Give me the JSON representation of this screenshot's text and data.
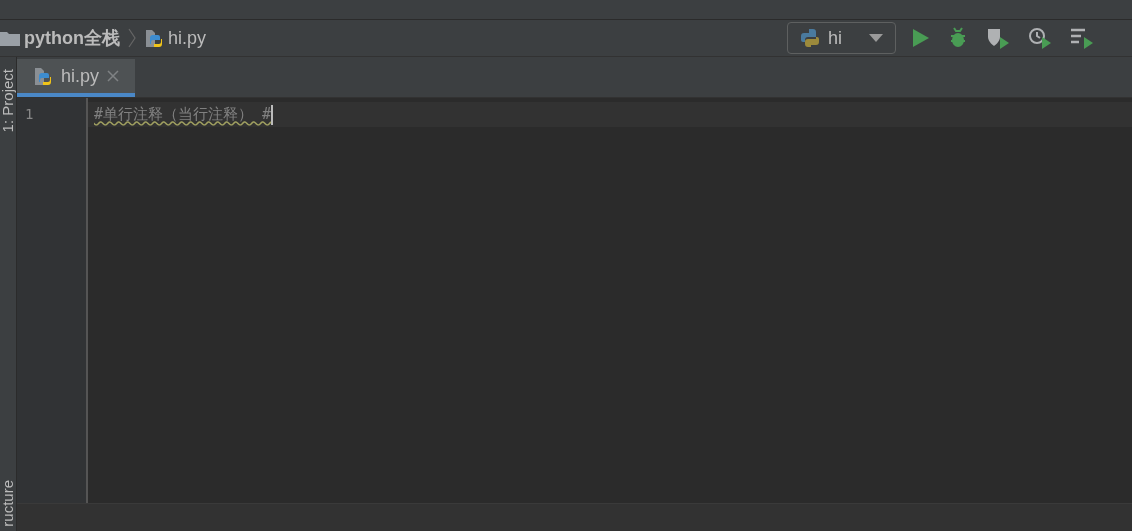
{
  "navigation_bar": {
    "breadcrumbs": [
      {
        "label": "python全栈",
        "kind": "folder"
      },
      {
        "label": "hi.py",
        "kind": "file"
      }
    ],
    "run_configuration": "hi"
  },
  "side_tabs": {
    "top": "1: Project",
    "bottom": "ructure"
  },
  "tabs": [
    {
      "label": "hi.py",
      "selected": true
    }
  ],
  "editor": {
    "lines": [
      {
        "number": "1",
        "text": "#单行注释（当行注释） #",
        "current": true
      }
    ]
  }
}
